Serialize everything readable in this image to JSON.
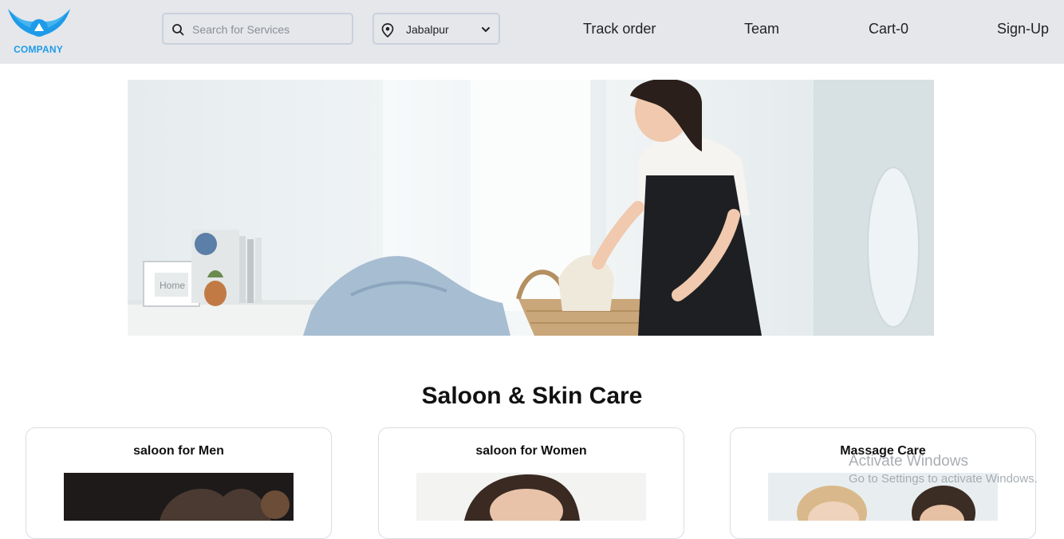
{
  "brand": {
    "logo_text": "COMPANY",
    "color": "#1e9be8"
  },
  "search": {
    "placeholder": "Search for Services",
    "icon": "search-icon"
  },
  "location": {
    "selected": "Jabalpur",
    "icon": "location-pin-icon"
  },
  "nav": {
    "track_order": "Track order",
    "team": "Team",
    "cart": "Cart-0",
    "signup": "Sign-Up"
  },
  "section": {
    "title": "Saloon & Skin Care"
  },
  "cards": [
    {
      "title": "saloon for Men"
    },
    {
      "title": "saloon for Women"
    },
    {
      "title": "Massage Care"
    }
  ],
  "os_watermark": {
    "line1": "Activate Windows",
    "line2": "Go to Settings to activate Windows."
  }
}
